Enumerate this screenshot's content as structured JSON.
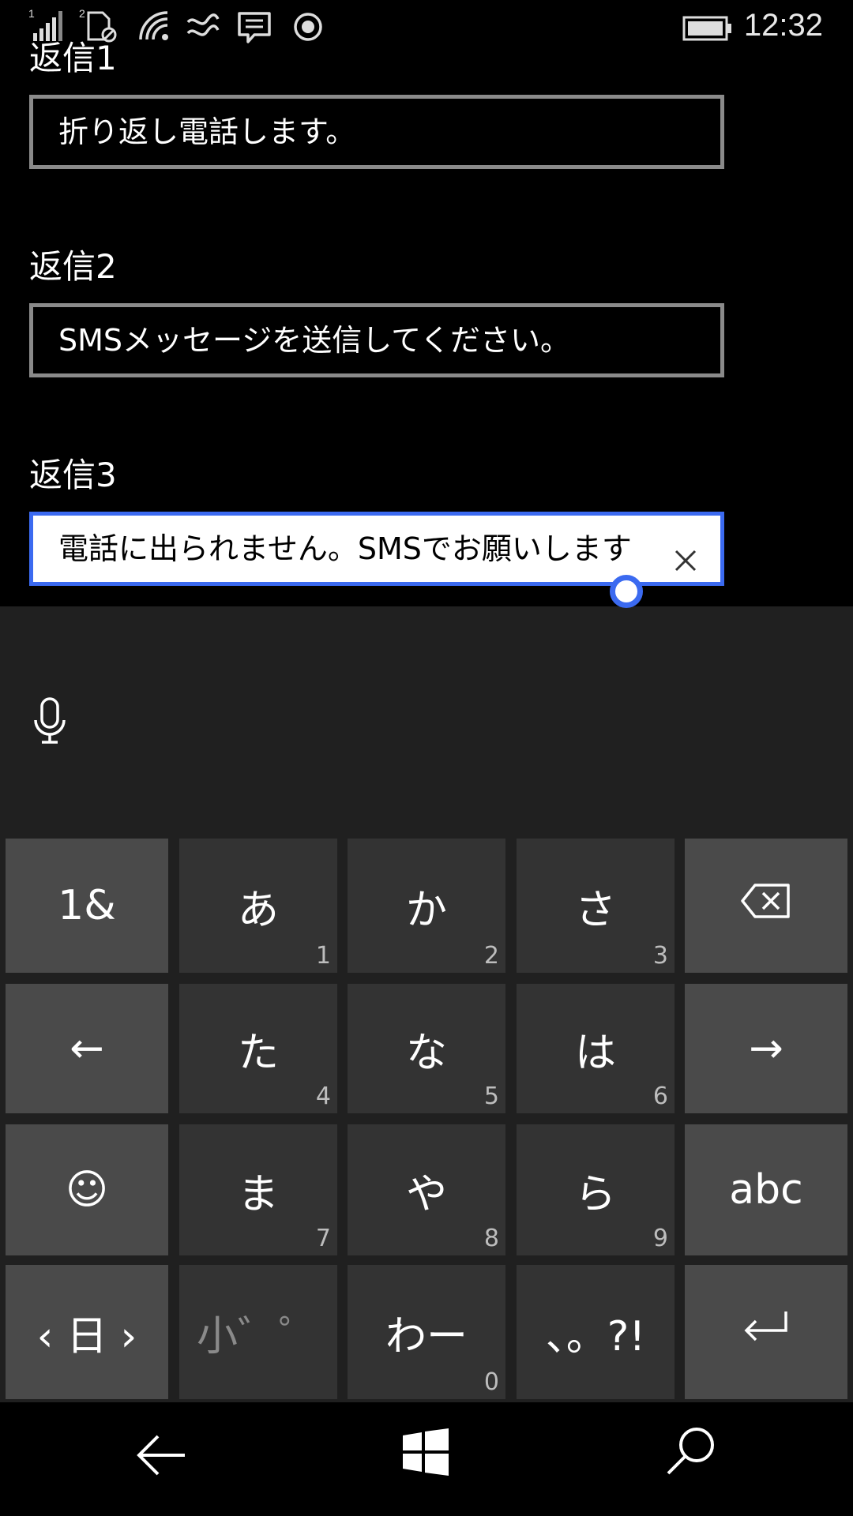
{
  "status": {
    "time": "12:32",
    "sim1": "1",
    "sim2": "2"
  },
  "fields": [
    {
      "label": "返信1",
      "value": "折り返し電話します。"
    },
    {
      "label": "返信2",
      "value": "SMSメッセージを送信してください。"
    },
    {
      "label": "返信3",
      "value": "電話に出られません。SMSでお願いします"
    }
  ],
  "keyboard": {
    "rows": [
      [
        {
          "label": "1&"
        },
        {
          "label": "あ",
          "sub": "1"
        },
        {
          "label": "か",
          "sub": "2"
        },
        {
          "label": "さ",
          "sub": "3"
        },
        {
          "label": "",
          "icon": "backspace-icon"
        }
      ],
      [
        {
          "label": "←"
        },
        {
          "label": "た",
          "sub": "4"
        },
        {
          "label": "な",
          "sub": "5"
        },
        {
          "label": "は",
          "sub": "6"
        },
        {
          "label": "→"
        }
      ],
      [
        {
          "label": "☺"
        },
        {
          "label": "ま",
          "sub": "7"
        },
        {
          "label": "や",
          "sub": "8"
        },
        {
          "label": "ら",
          "sub": "9"
        },
        {
          "label": "abc"
        }
      ],
      [
        {
          "label": "‹ 日 ›"
        },
        {
          "label": "小゛゜"
        },
        {
          "label": "わー",
          "sub": "0"
        },
        {
          "label": "、。?!"
        },
        {
          "label": "",
          "icon": "enter-icon"
        }
      ]
    ]
  },
  "icons": [
    "signal-icon",
    "no-sim-icon",
    "wifi-icon",
    "nfc-icon",
    "message-icon",
    "record-icon",
    "battery-icon",
    "microphone-icon",
    "clear-icon",
    "back-icon",
    "windows-icon",
    "search-icon",
    "backspace-icon",
    "enter-icon"
  ],
  "colors": {
    "accent": "#3b6af0",
    "key_bg": "#333333",
    "fn_key_bg": "#4a4a4a",
    "keyboard_bg": "#202020"
  }
}
